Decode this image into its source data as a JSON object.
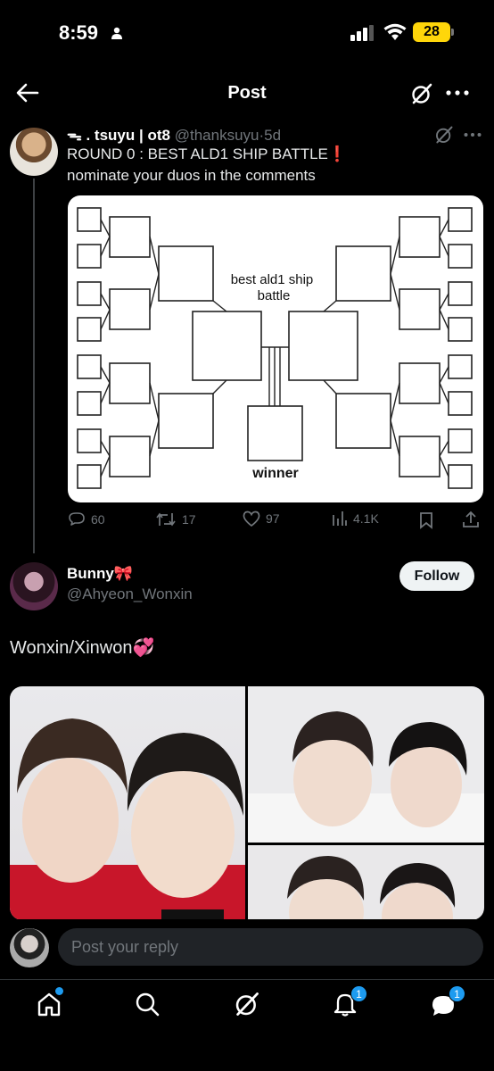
{
  "status_bar": {
    "time": "8:59",
    "battery": "28"
  },
  "header": {
    "title": "Post"
  },
  "tweet": {
    "author_name": "ᯓ . tsuyu | ot8",
    "handle": "@thanksuyu",
    "time": "5d",
    "line1": "ROUND 0 : BEST ALD1 SHIP BATTLE",
    "line1_mark": "❗",
    "line2": "nominate your duos in the comments",
    "bracket_image": {
      "title_line1": "best ald1 ship",
      "title_line2": "battle",
      "winner_label": "winner"
    },
    "actions": {
      "replies": "60",
      "reposts": "17",
      "likes": "97",
      "views": "4.1K"
    }
  },
  "reply": {
    "author_name": "Bunny🎀",
    "handle": "@Ahyeon_Wonxin",
    "follow_label": "Follow",
    "text": "Wonxin/Xinwon💞"
  },
  "composer": {
    "placeholder": "Post your reply"
  },
  "bottom_nav": {
    "items": [
      "home-icon",
      "search-icon",
      "grok-icon",
      "notifications-icon",
      "messages-icon"
    ],
    "notifications_badge": "1",
    "messages_badge": "1"
  },
  "colors": {
    "accent": "#1d9bf0",
    "background": "#000000",
    "muted": "#71767b",
    "text": "#e7e9ea"
  }
}
